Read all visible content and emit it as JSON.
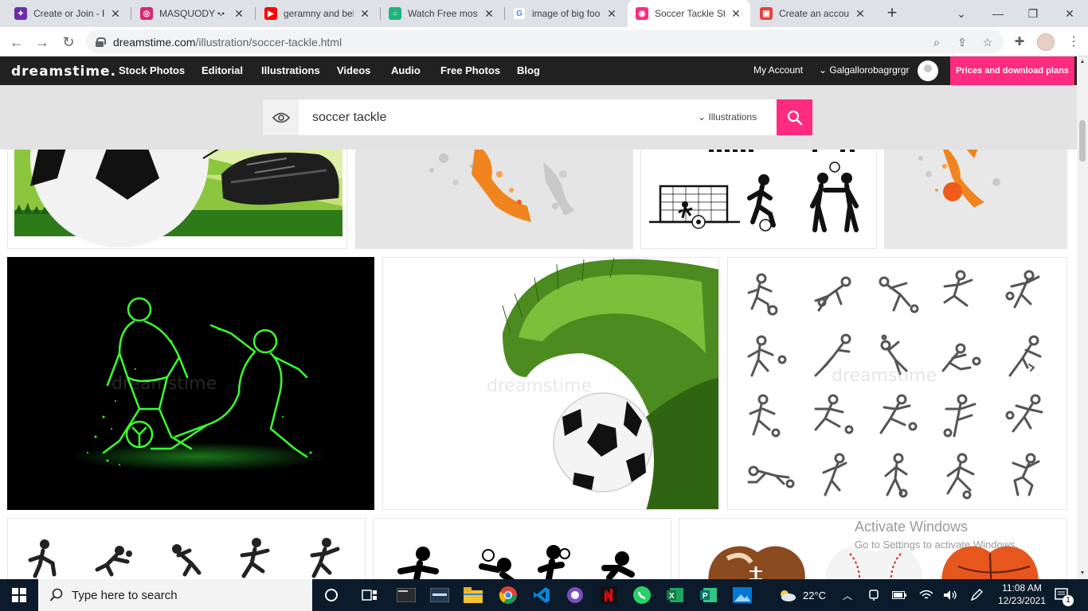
{
  "browser": {
    "tabs": [
      {
        "title": "Create or Join - F",
        "favicon_color": "#6b2ea8",
        "favicon_glyph": "✦"
      },
      {
        "title": "MASQUODY💀⚠",
        "favicon_color": "#d62976",
        "favicon_glyph": "◎"
      },
      {
        "title": "geramny and bel",
        "favicon_color": "#ff0000",
        "favicon_glyph": "▶"
      },
      {
        "title": "Watch Free most",
        "favicon_color": "#1fb47a",
        "favicon_glyph": "○"
      },
      {
        "title": "image of big foo",
        "favicon_color": "#4285f4",
        "favicon_glyph": "G"
      },
      {
        "title": "Soccer Tackle Sto",
        "favicon_color": "#ff2b7f",
        "favicon_glyph": "◉"
      },
      {
        "title": "Create an accoun",
        "favicon_color": "#e8413b",
        "favicon_glyph": "▣"
      }
    ],
    "active_tab": 5,
    "url_domain": "dreamstime.com",
    "url_path": "/illustration/soccer-tackle.html"
  },
  "site": {
    "logo": "dreamstime.",
    "nav": [
      "Stock Photos",
      "Editorial",
      "Illustrations",
      "Videos",
      "Audio",
      "Free Photos",
      "Blog"
    ],
    "my_account": "My Account",
    "username": "Galgallorobagrgrgr",
    "prices_label": "Prices and download plans",
    "accent": "#ff2b7f"
  },
  "search": {
    "value": "soccer tackle",
    "category": "Illustrations"
  },
  "gallery": {
    "watermark": "dreamstime"
  },
  "activate": {
    "line1": "Activate Windows",
    "line2": "Go to Settings to activate Windows."
  },
  "taskbar": {
    "search_placeholder": "Type here to search",
    "weather": "22°C",
    "time": "11:08 AM",
    "date": "12/23/2021",
    "notification_count": "1"
  }
}
